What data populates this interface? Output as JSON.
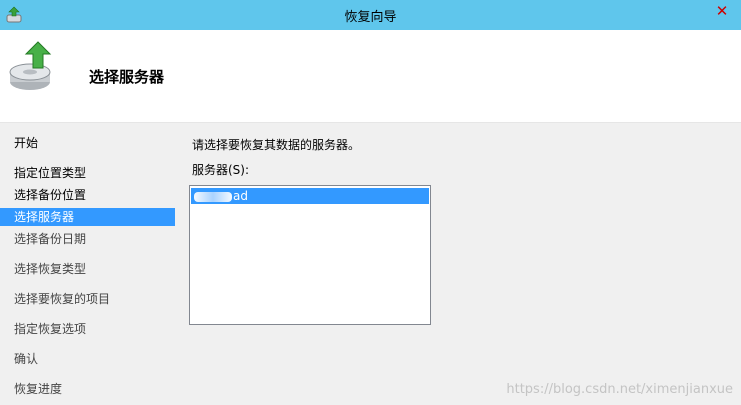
{
  "window": {
    "title": "恢复向导",
    "close_glyph": "✕"
  },
  "header": {
    "title": "选择服务器",
    "icon": "backup-disk-icon"
  },
  "sidebar": {
    "items": [
      {
        "label": "开始"
      },
      {
        "label": "指定位置类型"
      },
      {
        "label": "选择备份位置"
      },
      {
        "label": "选择服务器",
        "selected": true
      },
      {
        "label": "选择备份日期"
      },
      {
        "label": "选择恢复类型"
      },
      {
        "label": "选择要恢复的项目"
      },
      {
        "label": "指定恢复选项"
      },
      {
        "label": "确认"
      },
      {
        "label": "恢复进度"
      }
    ]
  },
  "main": {
    "instruction": "请选择要恢复其数据的服务器。",
    "servers_label": "服务器(S):",
    "servers": [
      {
        "name_visible": "ad",
        "selected": true
      }
    ]
  },
  "watermark": "https://blog.csdn.net/ximenjianxue",
  "colors": {
    "titlebar": "#5fc6ec",
    "selection": "#3399ff",
    "panel": "#f0f0f0"
  }
}
